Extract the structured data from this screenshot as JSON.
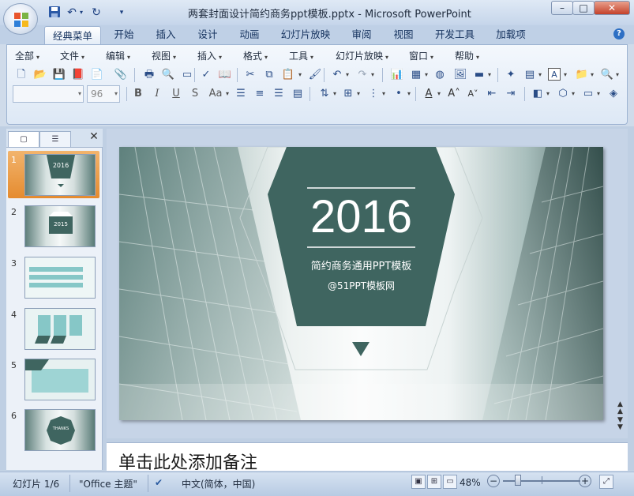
{
  "window": {
    "title": "两套封面设计简约商务ppt模板.pptx - Microsoft PowerPoint",
    "controls": {
      "minimize": "–",
      "maximize": "□",
      "close": "✕"
    }
  },
  "quick_access": [
    "save-icon",
    "undo-icon",
    "redo-icon",
    "customize-icon"
  ],
  "ribbon": {
    "tabs": [
      "经典菜单",
      "开始",
      "插入",
      "设计",
      "动画",
      "幻灯片放映",
      "审阅",
      "视图",
      "开发工具",
      "加载项"
    ],
    "active_tab": "经典菜单",
    "menus": [
      "全部",
      "文件",
      "编辑",
      "视图",
      "插入",
      "格式",
      "工具",
      "幻灯片放映",
      "窗口",
      "帮助"
    ],
    "font_name": "",
    "font_size": "96",
    "format_buttons": [
      "B",
      "I",
      "U",
      "S",
      "Aa"
    ]
  },
  "thumbnails": {
    "items": [
      {
        "num": "1",
        "label": "2016"
      },
      {
        "num": "2",
        "label": "2015"
      },
      {
        "num": "3",
        "label": ""
      },
      {
        "num": "4",
        "label": ""
      },
      {
        "num": "5",
        "label": ""
      },
      {
        "num": "6",
        "label": "THANKS"
      }
    ],
    "selected": 1
  },
  "slide": {
    "year": "2016",
    "subtitle": "简约商务通用PPT模板",
    "site": "@51PPT模板网",
    "accent_color": "#3f6560"
  },
  "notes": {
    "placeholder": "单击此处添加备注"
  },
  "status": {
    "slide_info": "幻灯片 1/6",
    "theme": "\"Office 主题\"",
    "language": "中文(简体，中国)",
    "zoom": "48%"
  }
}
